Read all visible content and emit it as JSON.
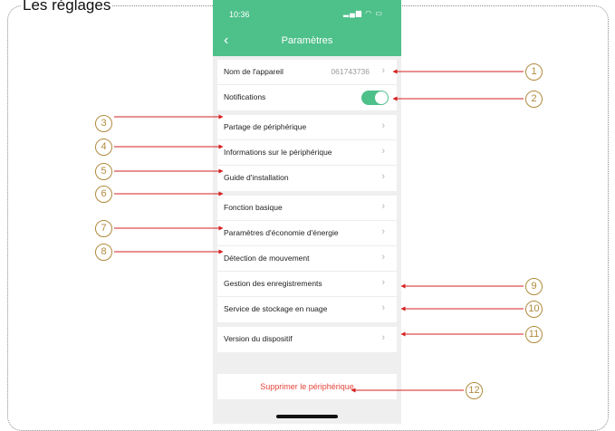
{
  "document": {
    "title": "Les réglages"
  },
  "phone": {
    "status_bar": {
      "time": "10:36",
      "icons": "signal-wifi-battery"
    },
    "nav": {
      "back_icon": "chevron-left-icon",
      "title": "Paramètres"
    },
    "groups": [
      {
        "rows": [
          {
            "label": "Nom de l'appareil",
            "value": "061743736",
            "chevron": true
          },
          {
            "label": "Notifications",
            "toggle": true
          }
        ]
      },
      {
        "rows": [
          {
            "label": "Partage de périphérique",
            "chevron": true
          },
          {
            "label": "Informations sur le périphérique",
            "chevron": true
          },
          {
            "label": "Guide d'installation",
            "chevron": true
          }
        ]
      },
      {
        "rows": [
          {
            "label": "Fonction basique",
            "chevron": true
          },
          {
            "label": "Paramètres d'économie d'énergie",
            "chevron": true
          },
          {
            "label": "Détection de mouvement",
            "chevron": true
          },
          {
            "label": "Gestion des enregistrements",
            "chevron": true
          },
          {
            "label": "Service de stockage en nuage",
            "chevron": true
          }
        ]
      },
      {
        "rows": [
          {
            "label": "Version du dispositif",
            "chevron": true
          }
        ]
      }
    ],
    "delete_label": "Supprimer le périphérique"
  },
  "callouts": {
    "c1": "1",
    "c2": "2",
    "c3": "3",
    "c4": "4",
    "c5": "5",
    "c6": "6",
    "c7": "7",
    "c8": "8",
    "c9": "9",
    "c10": "10",
    "c11": "11",
    "c12": "12"
  },
  "colors": {
    "accent": "#4ec08a",
    "delete": "#e6453c",
    "callout": "#b08a3c",
    "arrow": "#d42020"
  }
}
